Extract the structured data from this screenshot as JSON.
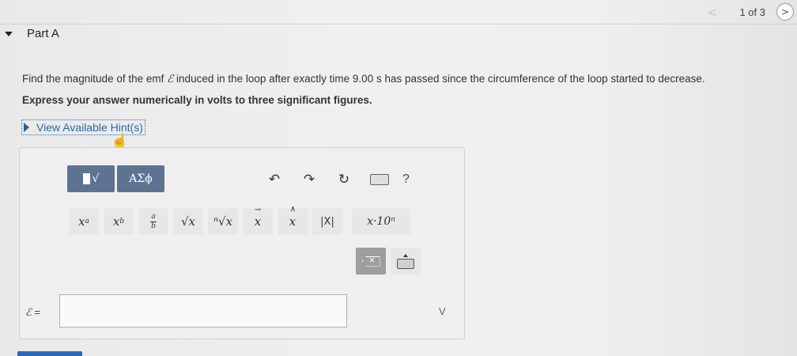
{
  "pager": {
    "prev_glyph": "<",
    "count": "1 of 3",
    "next_glyph": ">"
  },
  "part": {
    "title": "Part A"
  },
  "question": {
    "before": "Find the magnitude of the emf ",
    "symbol": "ℰ",
    "after": " induced in the loop after exactly time 9.00 s has passed since the circumference of the loop started to decrease."
  },
  "instruction": "Express your answer numerically in volts to three significant figures.",
  "hint": {
    "label": "View Available Hint(s)"
  },
  "toolbar": {
    "templates_glyph": "√",
    "greek_label": "ΑΣϕ",
    "undo_glyph": "↶",
    "redo_glyph": "↷",
    "reset_glyph": "↻",
    "help_label": "?"
  },
  "tools": {
    "superscript_base": "x",
    "superscript_exp": "a",
    "subscript_base": "x",
    "subscript_sub": "b",
    "fraction_num": "a",
    "fraction_den": "b",
    "sqrt": "√x",
    "nthroot": "ⁿ√x",
    "vector": "x",
    "unit_vector": "x",
    "abs": "|X|",
    "sci_notation": "x·10ⁿ"
  },
  "answer": {
    "symbol": "ℰ",
    "equals": " =",
    "value": "",
    "unit": "V"
  },
  "colors": {
    "accent_button": "#5d7391",
    "link": "#2a6aa8",
    "submit": "#2d68b4"
  }
}
